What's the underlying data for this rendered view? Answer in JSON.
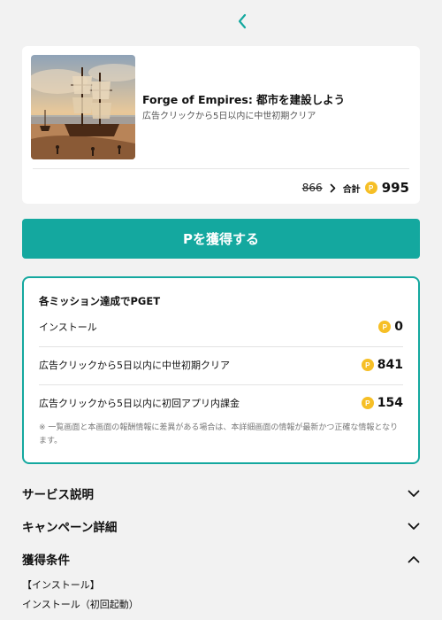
{
  "nav": {
    "back_icon": "chevron-left-icon"
  },
  "offer": {
    "title": "Forge of Empires: 都市を建設しよう",
    "subtitle": "広告クリックから5日以内に中世初期クリア",
    "old_points": "866",
    "total_label": "合計",
    "coin_glyph": "P",
    "total_points": "995"
  },
  "cta": {
    "label": "Pを獲得する"
  },
  "missions": {
    "heading": "各ミッション達成でPGET",
    "items": [
      {
        "label": "インストール",
        "points": "0"
      },
      {
        "label": "広告クリックから5日以内に中世初期クリア",
        "points": "841"
      },
      {
        "label": "広告クリックから5日以内に初回アプリ内課金",
        "points": "154"
      }
    ],
    "note": "※ 一覧画面と本画面の報酬情報に差異がある場合は、本詳細画面の情報が最新かつ正確な情報となります。"
  },
  "sections": {
    "service": {
      "title": "サービス説明",
      "state": "collapsed"
    },
    "campaign": {
      "title": "キャンペーン詳細",
      "state": "collapsed"
    },
    "conditions": {
      "title": "獲得条件",
      "state": "expanded",
      "lines": [
        "【インストール】",
        "インストール（初回起動）"
      ]
    }
  },
  "colors": {
    "accent": "#14a89f",
    "coin": "#f6bf26",
    "background": "#f2f2f2"
  }
}
